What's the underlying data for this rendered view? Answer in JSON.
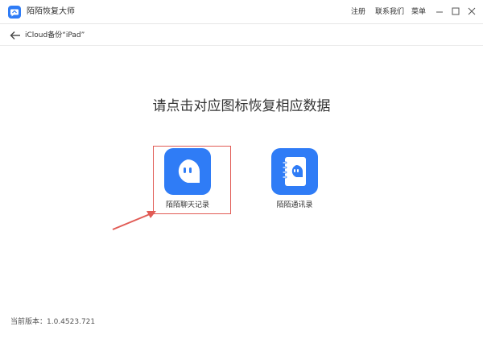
{
  "app": {
    "title": "陌陌恢复大师",
    "logo_icon": "momo-chat-logo-icon"
  },
  "menu": {
    "register": "注册",
    "contact": "联系我们",
    "menu": "菜单"
  },
  "window_controls": [
    "minimize-icon",
    "maximize-icon",
    "close-icon"
  ],
  "nav": {
    "breadcrumb": "iCloud备份“iPad”",
    "back_icon": "arrow-left-icon"
  },
  "headline": "请点击对应图标恢复相应数据",
  "tiles": [
    {
      "label": "陌陌聊天记录",
      "icon": "chat-bubble-icon",
      "highlighted": true
    },
    {
      "label": "陌陌通讯录",
      "icon": "address-book-icon",
      "highlighted": false
    }
  ],
  "annotation": {
    "color": "#e15b55"
  },
  "footer": {
    "version": "当前版本：1.0.4523.721"
  },
  "colors": {
    "accent": "#2f7cf6",
    "highlight": "#e15b55"
  }
}
